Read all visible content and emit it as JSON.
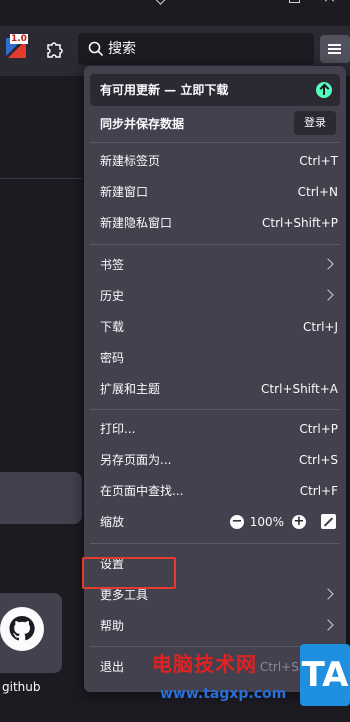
{
  "toolbar": {
    "extension_badge": "1.0",
    "search_placeholder": "搜索"
  },
  "menu": {
    "update_banner": "有可用更新 — 立即下载",
    "sync_label": "同步并保存数据",
    "login_label": "登录",
    "groups": [
      [
        {
          "label": "新建标签页",
          "shortcut": "Ctrl+T"
        },
        {
          "label": "新建窗口",
          "shortcut": "Ctrl+N"
        },
        {
          "label": "新建隐私窗口",
          "shortcut": "Ctrl+Shift+P"
        }
      ],
      [
        {
          "label": "书签",
          "submenu": true
        },
        {
          "label": "历史",
          "submenu": true
        },
        {
          "label": "下载",
          "shortcut": "Ctrl+J"
        },
        {
          "label": "密码",
          "shortcut": ""
        },
        {
          "label": "扩展和主题",
          "shortcut": "Ctrl+Shift+A"
        }
      ],
      [
        {
          "label": "打印...",
          "shortcut": "Ctrl+P"
        },
        {
          "label": "另存页面为...",
          "shortcut": "Ctrl+S"
        },
        {
          "label": "在页面中查找...",
          "shortcut": "Ctrl+F"
        }
      ]
    ],
    "zoom": {
      "label": "缩放",
      "value": "100%",
      "minus": "−",
      "plus": "+"
    },
    "settings": "设置",
    "more_tools": "更多工具",
    "help": "帮助",
    "exit": "退出",
    "exit_shortcut": "Ctrl+Shift+Q"
  },
  "page": {
    "shortcut_label": "github"
  },
  "watermark": {
    "title": "电脑技术网",
    "url": "www.tagxp.com",
    "logo": "TA"
  },
  "colors": {
    "panel": "#42414d",
    "accent_update": "#54ffbd",
    "highlight": "#e53a2c"
  }
}
